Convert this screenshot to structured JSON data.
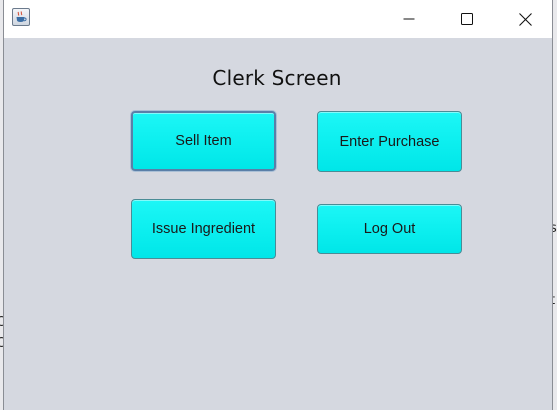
{
  "window": {
    "title": "",
    "icon": "java-coffee-cup-icon",
    "controls": [
      "minimize-icon",
      "maximize-icon",
      "close-icon"
    ]
  },
  "screen": {
    "title": "Clerk Screen"
  },
  "buttons": {
    "sell_item": "Sell Item",
    "enter_purchase": "Enter Purchase",
    "issue_ingredient": "Issue Ingredient",
    "log_out": "Log Out"
  },
  "background_edge": {
    "right_top": "s",
    "right_mid": "t",
    "left_a": "C",
    "left_b": "C"
  },
  "colors": {
    "button_fill": "#0ef0f0",
    "window_background": "#d5d8e0",
    "focus_border": "#5a7fa8"
  }
}
